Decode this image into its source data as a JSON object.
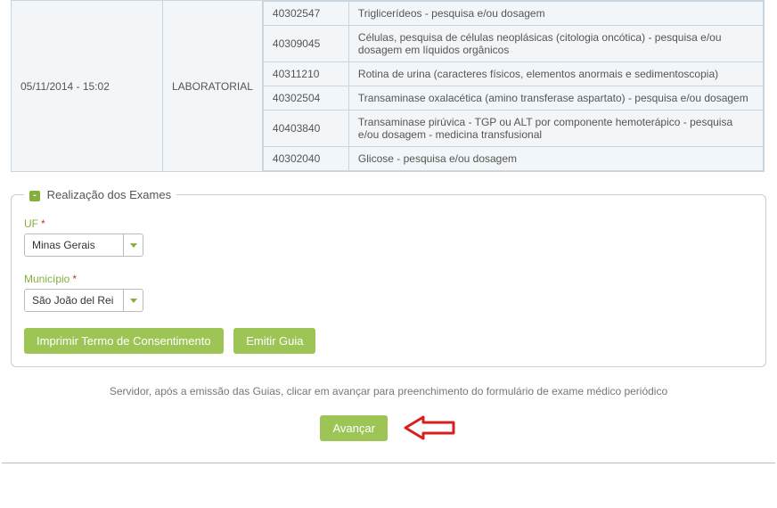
{
  "exam_block": {
    "date": "05/11/2014 - 15:02",
    "category": "LABORATORIAL",
    "rows": [
      {
        "code": "40302547",
        "desc": "Triglicerídeos - pesquisa e/ou dosagem"
      },
      {
        "code": "40309045",
        "desc": "Células, pesquisa de células neoplásicas (citologia oncótica) - pesquisa e/ou dosagem em líquidos orgânicos"
      },
      {
        "code": "40311210",
        "desc": "Rotina de urina (caracteres físicos, elementos anormais e sedimentoscopia)"
      },
      {
        "code": "40302504",
        "desc": "Transaminase oxalacética (amino transferase aspartato) - pesquisa e/ou dosagem"
      },
      {
        "code": "40403840",
        "desc": "Transaminase pirúvica - TGP ou ALT por componente hemoterápico - pesquisa e/ou dosagem - medicina transfusional"
      },
      {
        "code": "40302040",
        "desc": "Glicose - pesquisa e/ou dosagem"
      }
    ]
  },
  "fieldset": {
    "collapse_glyph": "-",
    "legend": "Realização dos Exames",
    "uf_label": "UF",
    "uf_value": "Minas Gerais",
    "mun_label": "Município",
    "mun_value": "São João del Rei",
    "btn_print": "Imprimir Termo de Consentimento",
    "btn_emit": "Emitir Guia"
  },
  "footer": {
    "info": "Servidor, após a emissão das Guias, clicar em avançar para preenchimento do formulário de exame médico periódico",
    "advance": "Avançar"
  },
  "colors": {
    "accent": "#9dc556",
    "arrow": "#d62020"
  }
}
